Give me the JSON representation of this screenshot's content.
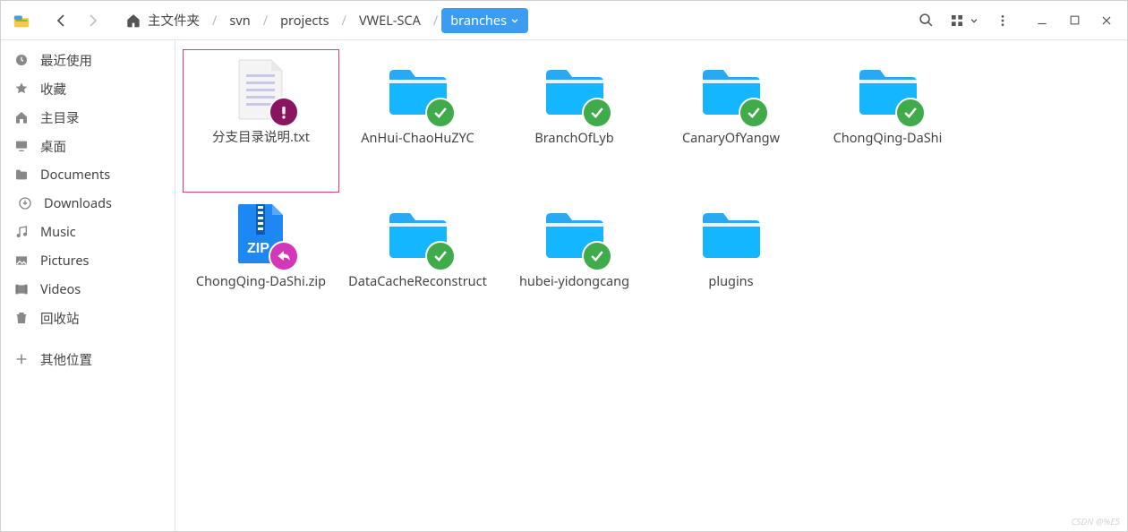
{
  "breadcrumbs": {
    "home": "主文件夹",
    "items": [
      "svn",
      "projects",
      "VWEL-SCA"
    ],
    "current": "branches"
  },
  "sidebar": {
    "items": [
      {
        "icon": "clock",
        "label": "最近使用"
      },
      {
        "icon": "star",
        "label": "收藏"
      },
      {
        "icon": "home",
        "label": "主目录"
      },
      {
        "icon": "desktop",
        "label": "桌面"
      },
      {
        "icon": "folder",
        "label": "Documents"
      },
      {
        "icon": "download",
        "label": "Downloads",
        "indent": true
      },
      {
        "icon": "music",
        "label": "Music"
      },
      {
        "icon": "picture",
        "label": "Pictures"
      },
      {
        "icon": "video",
        "label": "Videos"
      },
      {
        "icon": "trash",
        "label": "回收站"
      }
    ],
    "other": {
      "icon": "plus",
      "label": "其他位置"
    }
  },
  "files": [
    {
      "type": "text",
      "label": "分支目录说明.txt",
      "status": "warn",
      "selected": true
    },
    {
      "type": "folder",
      "label": "AnHui-ChaoHuZYC",
      "status": "ok"
    },
    {
      "type": "folder",
      "label": "BranchOfLyb",
      "status": "ok"
    },
    {
      "type": "folder",
      "label": "CanaryOfYangw",
      "status": "ok"
    },
    {
      "type": "folder",
      "label": "ChongQing-DaShi",
      "status": "ok"
    },
    {
      "type": "zip",
      "label": "ChongQing-DaShi.zip",
      "status": "share"
    },
    {
      "type": "folder",
      "label": "DataCacheReconstruct",
      "status": "ok"
    },
    {
      "type": "folder",
      "label": "hubei-yidongcang",
      "status": "ok"
    },
    {
      "type": "folder",
      "label": "plugins",
      "status": null
    }
  ],
  "watermark": "CSDN @%E5"
}
